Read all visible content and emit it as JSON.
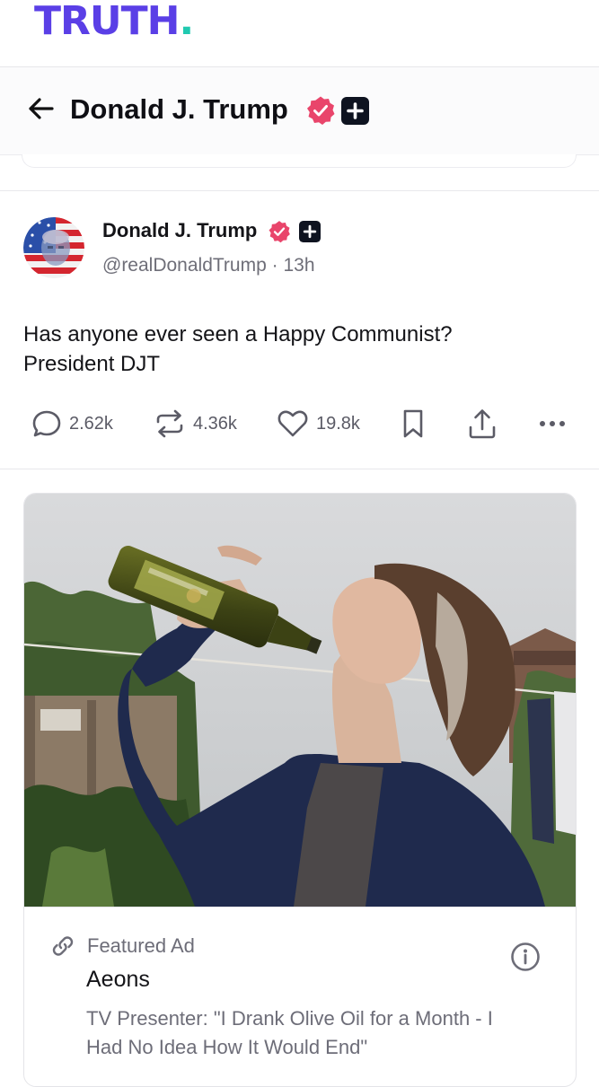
{
  "brand": {
    "name": "TRUTH",
    "dot": "."
  },
  "header": {
    "title": "Donald J. Trump"
  },
  "post": {
    "author_name": "Donald J. Trump",
    "handle": "@realDonaldTrump",
    "separator": "·",
    "time": "13h",
    "text_line1": "Has anyone ever seen a Happy Communist?",
    "text_line2": "President DJT",
    "actions": {
      "replies": "2.62k",
      "retruths": "4.36k",
      "likes": "19.8k"
    }
  },
  "ad": {
    "label": "Featured Ad",
    "advertiser": "Aeons",
    "headline": "TV Presenter: \"I Drank Olive Oil for a Month - I Had No Idea How It Would End\""
  },
  "colors": {
    "brand_purple": "#5a3fe6",
    "brand_teal": "#20c9b0",
    "verified_pink": "#e9456b",
    "text_dark": "#141418",
    "text_muted": "#6e6e78"
  },
  "icons": [
    "back-arrow-icon",
    "verified-badge-icon",
    "plus-badge-icon",
    "reply-icon",
    "retruth-icon",
    "like-icon",
    "bookmark-icon",
    "share-icon",
    "more-icon",
    "link-icon",
    "info-icon"
  ]
}
